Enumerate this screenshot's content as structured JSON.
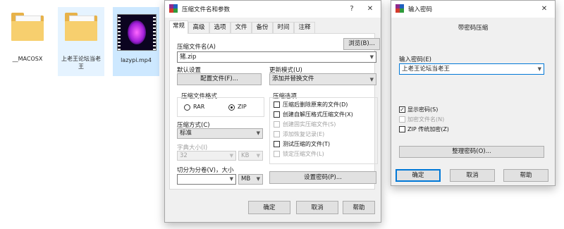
{
  "desktop": {
    "files": [
      {
        "name": "__MACOSX",
        "type": "folder"
      },
      {
        "name": "上老王论坛当老王",
        "type": "folder"
      },
      {
        "name": "lazypi.mp4",
        "type": "video"
      }
    ]
  },
  "archive_dialog": {
    "title": "压缩文件名和参数",
    "help_glyph": "?",
    "close_glyph": "✕",
    "tabs": [
      "常规",
      "高级",
      "选项",
      "文件",
      "备份",
      "时间",
      "注释"
    ],
    "active_tab": "常规",
    "archive_name_label": "压缩文件名(A)",
    "browse_button": "浏览(B)...",
    "archive_name_value": "猪.zip",
    "default_settings_label": "默认设置",
    "profiles_button": "配置文件(F)...",
    "update_mode_label": "更新模式(U)",
    "update_mode_value": "添加并替换文件",
    "format_group_label": "压缩文件格式",
    "format_rar": "RAR",
    "format_zip": "ZIP",
    "selected_format": "ZIP",
    "options_group_label": "压缩选项",
    "options": [
      {
        "label": "压缩后删除原来的文件(D)",
        "checked": false,
        "enabled": true
      },
      {
        "label": "创建自解压格式压缩文件(X)",
        "checked": false,
        "enabled": true
      },
      {
        "label": "创建固实压缩文件(S)",
        "checked": false,
        "enabled": false
      },
      {
        "label": "添加恢复记录(E)",
        "checked": false,
        "enabled": false
      },
      {
        "label": "测试压缩的文件(T)",
        "checked": false,
        "enabled": true
      },
      {
        "label": "锁定压缩文件(L)",
        "checked": false,
        "enabled": false
      }
    ],
    "method_label": "压缩方式(C)",
    "method_value": "标准",
    "dict_size_label": "字典大小(I)",
    "dict_size_value": "32",
    "dict_unit_value": "KB",
    "split_label": "切分为分卷(V)，大小",
    "split_value": "",
    "split_unit_value": "MB",
    "set_password_button": "设置密码(P)...",
    "ok_button": "确定",
    "cancel_button": "取消",
    "help_button": "帮助"
  },
  "password_dialog": {
    "title": "输入密码",
    "close_glyph": "✕",
    "heading": "带密码压缩",
    "password_label": "输入密码(E)",
    "password_value": "上老王论坛当老王",
    "checks": [
      {
        "label": "显示密码(S)",
        "checked": true,
        "enabled": true
      },
      {
        "label": "加密文件名(N)",
        "checked": false,
        "enabled": false
      },
      {
        "label": "ZIP 传统加密(Z)",
        "checked": false,
        "enabled": true
      }
    ],
    "organize_button": "整理密码(O)...",
    "ok_button": "确定",
    "cancel_button": "取消",
    "help_button": "帮助"
  },
  "colors": {
    "selection": "#cde8ff",
    "accent": "#0078d7",
    "dialog_bg": "#f0f0f0"
  }
}
